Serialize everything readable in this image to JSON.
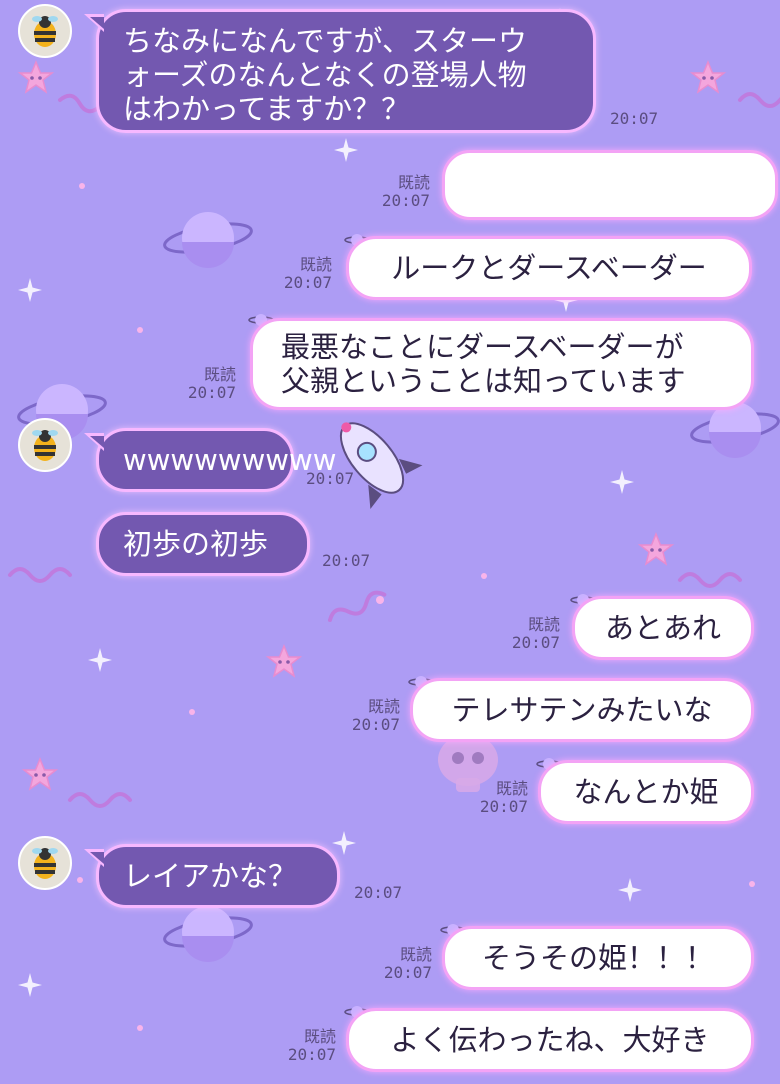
{
  "incoming_messages": [
    {
      "lines": [
        "ちなみになんですが、スターウ",
        "ォーズのなんとなくの登場人物",
        "はわかってますか？？"
      ],
      "time": "20:07"
    },
    {
      "text": "wwwwwwwww",
      "time": "20:07"
    },
    {
      "text": "初歩の初歩",
      "time": "20:07"
    },
    {
      "text": "レイアかな？",
      "time": "20:07"
    }
  ],
  "outgoing_messages": [
    {
      "text": "",
      "read_label": "既読",
      "time": "20:07"
    },
    {
      "text": "ルークとダースベーダー",
      "read_label": "既読",
      "time": "20:07"
    },
    {
      "lines": [
        "最悪なことにダースベーダーが",
        "父親ということは知っています"
      ],
      "read_label": "既読",
      "time": "20:07"
    },
    {
      "text": "あとあれ",
      "read_label": "既読",
      "time": "20:07"
    },
    {
      "text": "テレサテンみたいな",
      "read_label": "既読",
      "time": "20:07"
    },
    {
      "text": "なんとか姫",
      "read_label": "既読",
      "time": "20:07"
    },
    {
      "text": "そうその姫！！！",
      "read_label": "既読",
      "time": "20:07"
    },
    {
      "text": "よく伝わったね、大好き",
      "read_label": "既読",
      "time": "20:07"
    }
  ],
  "icons": {
    "avatar": "bee-avatar-icon",
    "read_marker": "planet-icon",
    "background": "space-stickers-wallpaper"
  },
  "colors": {
    "background": "#ad9cf4",
    "incoming_bubble": "#7358b0",
    "outgoing_bubble": "#ffffff",
    "bubble_glow": "#f3a3f5"
  }
}
